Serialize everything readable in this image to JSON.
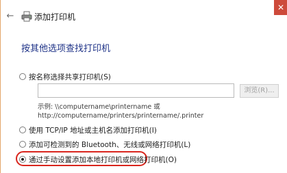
{
  "window": {
    "title": "添加打印机",
    "close_glyph": "✕",
    "back_glyph": "←"
  },
  "heading": "按其他选项查找打印机",
  "options": [
    {
      "label": "按名称选择共享打印机(S)",
      "selected": false
    },
    {
      "label": "使用 TCP/IP 地址或主机名添加打印机(I)",
      "selected": false
    },
    {
      "label": "添加可检测到的 Bluetooth、无线或网络打印机(L)",
      "selected": false
    },
    {
      "label": "通过手动设置添加本地打印机或网络打印机(O)",
      "selected": true
    }
  ],
  "share_input": {
    "value": ""
  },
  "browse_button": "浏览(R)...",
  "example_line1": "示例: \\\\computername\\printername 或",
  "example_line2": "http://computername/printers/printername/.printer",
  "colors": {
    "accent_border": "#e3a56a",
    "heading": "#1e3287",
    "close": "#cd4a3b",
    "highlight": "#d9241c"
  }
}
